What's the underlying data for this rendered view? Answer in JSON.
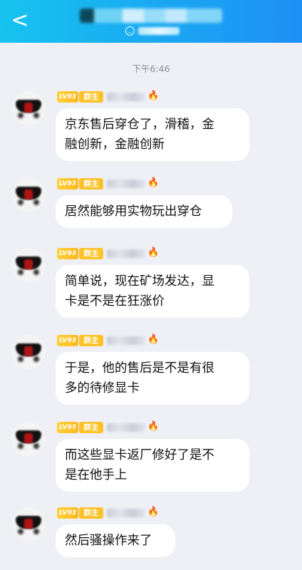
{
  "header": {
    "back_icon": "back-chevron-icon",
    "title": "",
    "subtitle": ""
  },
  "chat": {
    "timestamp": "下午6:46",
    "messages": [
      {
        "level": "LV93",
        "role": "群主",
        "text": "京东售后穿仓了，滑稽，金\n融创新，金融创新"
      },
      {
        "level": "LV93",
        "role": "群主",
        "text": "居然能够用实物玩出穿仓"
      },
      {
        "level": "LV93",
        "role": "群主",
        "text": "简单说，现在矿场发达，显\n卡是不是在狂涨价"
      },
      {
        "level": "LV93",
        "role": "群主",
        "text": "于是，他的售后是不是有很\n多的待修显卡"
      },
      {
        "level": "LV93",
        "role": "群主",
        "text": "而这些显卡返厂修好了是不\n是在他手上"
      },
      {
        "level": "LV93",
        "role": "群主",
        "text": "然后骚操作来了"
      }
    ]
  },
  "colors": {
    "header_start": "#17c3ef",
    "header_end": "#1d8ff5",
    "background": "#eef0f6",
    "badge": "#ffc228"
  }
}
